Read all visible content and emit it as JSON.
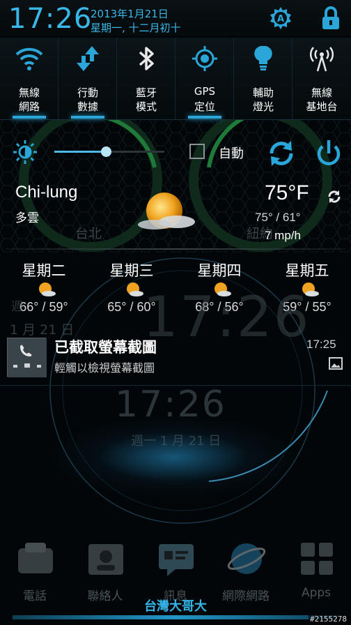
{
  "header": {
    "time": "17:26",
    "date_line1": "2013年1月21日",
    "date_line2": "星期一, 十二月初十",
    "auto_rotate_icon": "a-badge-icon",
    "lock_icon": "lock-icon"
  },
  "toggles": [
    {
      "name": "wifi",
      "icon": "wifi-icon",
      "label1": "無線",
      "label2": "網路"
    },
    {
      "name": "mobile-data",
      "icon": "mobile-data-icon",
      "label1": "行動",
      "label2": "數據"
    },
    {
      "name": "bluetooth",
      "icon": "bluetooth-icon",
      "label1": "藍牙",
      "label2": "模式"
    },
    {
      "name": "gps",
      "icon": "gps-icon",
      "label1": "GPS",
      "label2": "定位"
    },
    {
      "name": "flashlight",
      "icon": "flashlight-icon",
      "label1": "輔助",
      "label2": "燈光"
    },
    {
      "name": "hotspot",
      "icon": "hotspot-icon",
      "label1": "無線",
      "label2": "基地台"
    }
  ],
  "brightness": {
    "level": 0.47,
    "auto_label": "自動",
    "auto_checked": false
  },
  "weather": {
    "city": "Chi-lung",
    "condition": "多雲",
    "temperature": "75°F",
    "hi_lo": "75° / 61°",
    "wind": "7 mp/h",
    "bg_city_left": "台北",
    "bg_city_right": "紐約",
    "forecast": [
      {
        "day": "星期二",
        "temps": "66° / 59°"
      },
      {
        "day": "星期三",
        "temps": "65° / 60°"
      },
      {
        "day": "星期四",
        "temps": "68° / 56°"
      },
      {
        "day": "星期五",
        "temps": "59° / 55°"
      }
    ]
  },
  "notification": {
    "title": "已截取螢幕截圖",
    "subtitle": "輕觸以檢視螢幕截圖",
    "time": "17:25"
  },
  "background_widget": {
    "clock_big": "17:26",
    "weekday_fragment": "週",
    "date_small": "1 月 21 日",
    "clock_mid": "17:26",
    "date_mid": "週一 1 月 21 日"
  },
  "dock": [
    {
      "label": "電話",
      "icon": "phone-icon"
    },
    {
      "label": "聯絡人",
      "icon": "contacts-icon"
    },
    {
      "label": "訊息",
      "icon": "messages-icon"
    },
    {
      "label": "網際網路",
      "icon": "browser-globe-icon"
    },
    {
      "label": "Apps",
      "icon": "apps-grid-icon"
    }
  ],
  "carrier": "台灣大哥大",
  "watermark": "#2155278",
  "colors": {
    "accent": "#39b8e8",
    "background": "#000000"
  }
}
